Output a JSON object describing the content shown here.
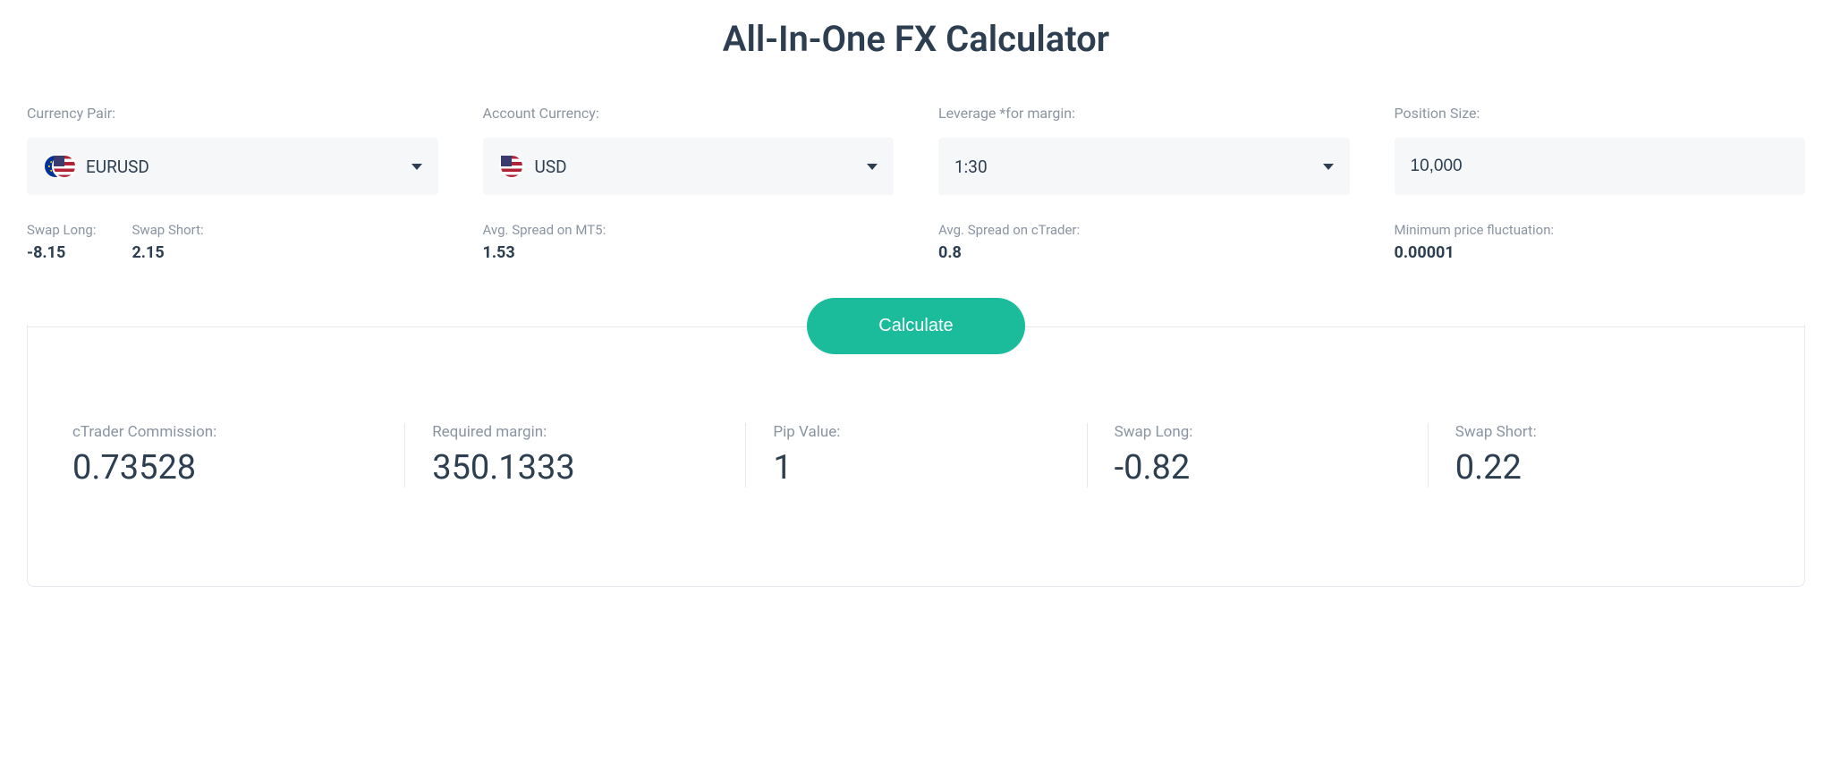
{
  "title": "All-In-One FX Calculator",
  "inputs": {
    "currency_pair": {
      "label": "Currency Pair:",
      "value": "EURUSD"
    },
    "account_currency": {
      "label": "Account Currency:",
      "value": "USD"
    },
    "leverage": {
      "label": "Leverage *for margin:",
      "value": "1:30"
    },
    "position_size": {
      "label": "Position Size:",
      "value": "10,000"
    }
  },
  "stats": {
    "swap_long": {
      "label": "Swap Long:",
      "value": "-8.15"
    },
    "swap_short": {
      "label": "Swap Short:",
      "value": "2.15"
    },
    "spread_mt5": {
      "label": "Avg. Spread on MT5:",
      "value": "1.53"
    },
    "spread_ctrader": {
      "label": "Avg. Spread on cTrader:",
      "value": "0.8"
    },
    "min_fluctuation": {
      "label": "Minimum price fluctuation:",
      "value": "0.00001"
    }
  },
  "calculate_label": "Calculate",
  "results": {
    "ctrader_commission": {
      "label": "cTrader Commission:",
      "value": "0.73528"
    },
    "required_margin": {
      "label": "Required margin:",
      "value": "350.1333"
    },
    "pip_value": {
      "label": "Pip Value:",
      "value": "1"
    },
    "swap_long": {
      "label": "Swap Long:",
      "value": "-0.82"
    },
    "swap_short": {
      "label": "Swap Short:",
      "value": "0.22"
    }
  }
}
